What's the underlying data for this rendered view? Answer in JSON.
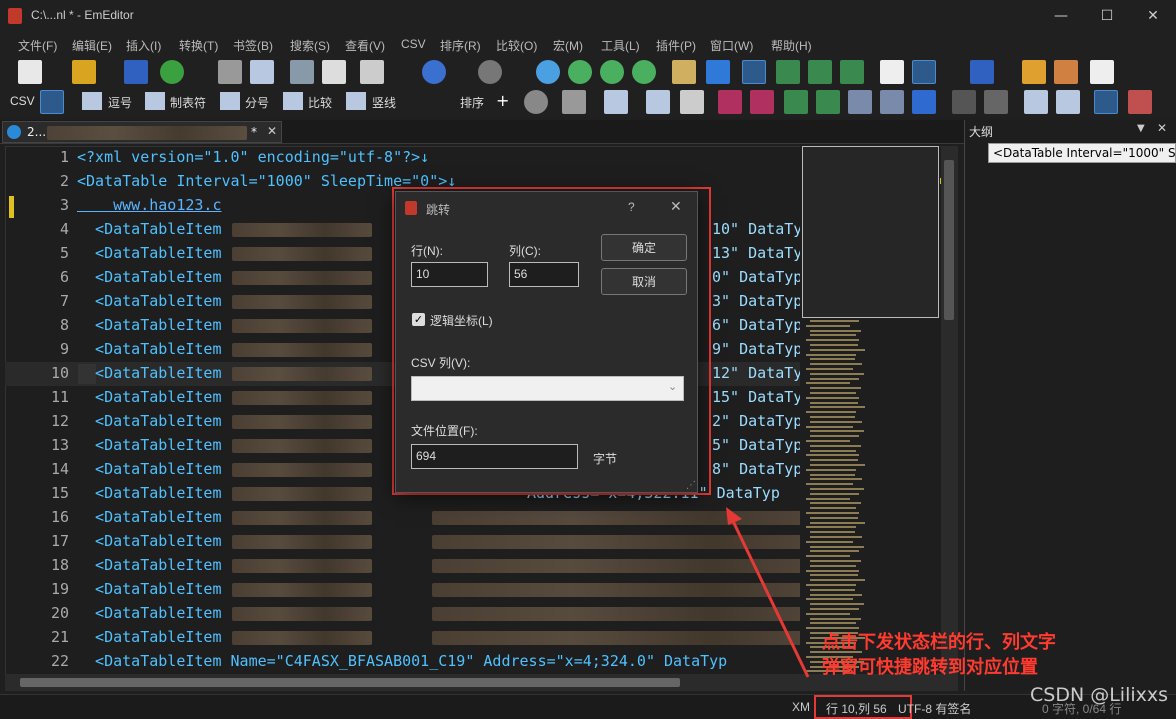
{
  "window": {
    "title": "C:\\...nl * - EmEditor"
  },
  "menu": [
    "文件(F)",
    "编辑(E)",
    "插入(I)",
    "转换(T)",
    "书签(B)",
    "搜索(S)",
    "查看(V)",
    "CSV",
    "排序(R)",
    "比较(O)",
    "宏(M)",
    "工具(L)",
    "插件(P)",
    "窗口(W)",
    "帮助(H)"
  ],
  "csv_toolbar": {
    "csv": "CSV",
    "comma": "逗号",
    "tab": "制表符",
    "semicolon": "分号",
    "compare": "比较",
    "vertical": "竖线",
    "sort": "排序"
  },
  "tab": {
    "name": "2...",
    "modified": "*"
  },
  "editor": {
    "lines": [
      {
        "n": "1",
        "code": "<?xml version=\"1.0\" encoding=\"utf-8\"?>↓"
      },
      {
        "n": "2",
        "code": "<DataTable Interval=\"1000\" SleepTime=\"0\">↓"
      },
      {
        "n": "3",
        "code": "    www.hao123.c"
      },
      {
        "n": "4",
        "code": "  <DataTableItem",
        "tail": "10\" DataTyp"
      },
      {
        "n": "5",
        "code": "  <DataTableItem",
        "tail": "13\" DataTyp"
      },
      {
        "n": "6",
        "code": "  <DataTableItem",
        "tail": "0\" DataTyp"
      },
      {
        "n": "7",
        "code": "  <DataTableItem",
        "tail": "3\" DataTyp"
      },
      {
        "n": "8",
        "code": "  <DataTableItem",
        "tail": "6\" DataTyp"
      },
      {
        "n": "9",
        "code": "  <DataTableItem",
        "tail": "9\" DataTyp"
      },
      {
        "n": "10",
        "code": "  <DataTableItem",
        "tail": "12\" DataTyp"
      },
      {
        "n": "11",
        "code": "  <DataTableItem",
        "tail": "15\" DataTyp"
      },
      {
        "n": "12",
        "code": "  <DataTableItem",
        "tail": "2\" DataTyp"
      },
      {
        "n": "13",
        "code": "  <DataTableItem",
        "tail": "5\" DataTyp"
      },
      {
        "n": "14",
        "code": "  <DataTableItem",
        "tail": "8\" DataTyp"
      },
      {
        "n": "15",
        "code": "  <DataTableItem",
        "tail": "Address=\"x=4;322.11\" DataTyp"
      },
      {
        "n": "16",
        "code": "  <DataTableItem"
      },
      {
        "n": "17",
        "code": "  <DataTableItem"
      },
      {
        "n": "18",
        "code": "  <DataTableItem"
      },
      {
        "n": "19",
        "code": "  <DataTableItem"
      },
      {
        "n": "20",
        "code": "  <DataTableItem"
      },
      {
        "n": "21",
        "code": "  <DataTableItem"
      },
      {
        "n": "22",
        "code": "  <DataTableItem Name=\"C4FASX_BFASAB001_C19\" Address=\"x=4;324.0\" DataTyp"
      }
    ]
  },
  "outline": {
    "title": "大纲",
    "item": "<DataTable Interval=\"1000\" Sle"
  },
  "dialog": {
    "title": "跳转",
    "help": "?",
    "row_label": "行(N):",
    "row_value": "10",
    "col_label": "列(C):",
    "col_value": "56",
    "ok": "确定",
    "cancel": "取消",
    "logical_label": "逻辑坐标(L)",
    "csv_label": "CSV 列(V):",
    "filepos_label": "文件位置(F):",
    "filepos_value": "694",
    "unit": "字节"
  },
  "statusbar": {
    "type": "XM",
    "position": "行 10,列 56",
    "encoding": "UTF-8 有签名",
    "chars": "0 字符, 0/64 行"
  },
  "annotation": {
    "line1": "点击下发状态栏的行、列文字",
    "line2": "弹窗可快捷跳转到对应位置"
  },
  "watermark": "CSDN @Lilixxs",
  "colors": {
    "accent": "#2d5a8a",
    "highlight": "#e53935"
  }
}
